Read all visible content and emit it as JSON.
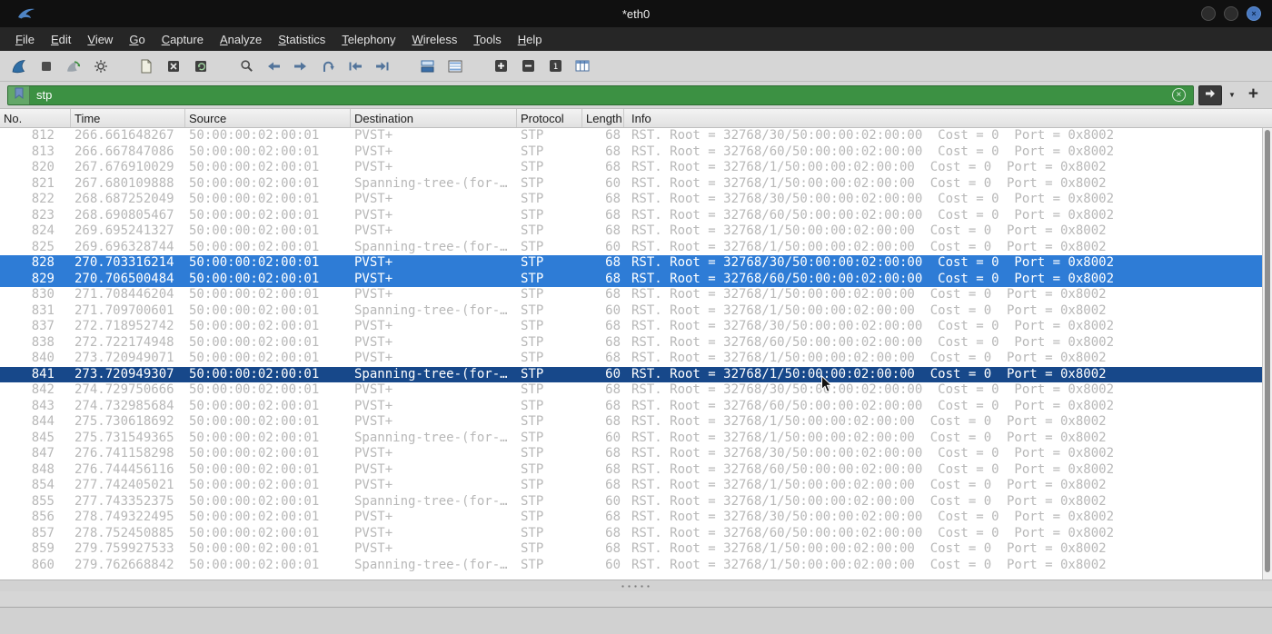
{
  "titlebar": {
    "title": "*eth0"
  },
  "menu": {
    "items": [
      "File",
      "Edit",
      "View",
      "Go",
      "Capture",
      "Analyze",
      "Statistics",
      "Telephony",
      "Wireless",
      "Tools",
      "Help"
    ]
  },
  "toolbar": {
    "icons": [
      "start-capture",
      "stop-capture",
      "restart-capture",
      "capture-options",
      "open-file",
      "close-file",
      "reload-file",
      "find-packet",
      "go-back",
      "go-forward",
      "go-to-packet",
      "go-first-packet",
      "go-last-packet",
      "auto-scroll",
      "colorize-packets",
      "zoom-in",
      "zoom-out",
      "zoom-original",
      "resize-columns"
    ]
  },
  "filter": {
    "value": "stp",
    "add_button_label": "+"
  },
  "packet_list": {
    "columns": [
      "No.",
      "Time",
      "Source",
      "Destination",
      "Protocol",
      "Length",
      "Info"
    ],
    "rows": [
      {
        "no": "812",
        "time": "266.661648267",
        "source": "50:00:00:02:00:01",
        "destination": "PVST+",
        "protocol": "STP",
        "length": "68",
        "info": "RST. Root = 32768/30/50:00:00:02:00:00  Cost = 0  Port = 0x8002"
      },
      {
        "no": "813",
        "time": "266.667847086",
        "source": "50:00:00:02:00:01",
        "destination": "PVST+",
        "protocol": "STP",
        "length": "68",
        "info": "RST. Root = 32768/60/50:00:00:02:00:00  Cost = 0  Port = 0x8002"
      },
      {
        "no": "820",
        "time": "267.676910029",
        "source": "50:00:00:02:00:01",
        "destination": "PVST+",
        "protocol": "STP",
        "length": "68",
        "info": "RST. Root = 32768/1/50:00:00:02:00:00  Cost = 0  Port = 0x8002"
      },
      {
        "no": "821",
        "time": "267.680109888",
        "source": "50:00:00:02:00:01",
        "destination": "Spanning-tree-(for-…",
        "protocol": "STP",
        "length": "60",
        "info": "RST. Root = 32768/1/50:00:00:02:00:00  Cost = 0  Port = 0x8002"
      },
      {
        "no": "822",
        "time": "268.687252049",
        "source": "50:00:00:02:00:01",
        "destination": "PVST+",
        "protocol": "STP",
        "length": "68",
        "info": "RST. Root = 32768/30/50:00:00:02:00:00  Cost = 0  Port = 0x8002"
      },
      {
        "no": "823",
        "time": "268.690805467",
        "source": "50:00:00:02:00:01",
        "destination": "PVST+",
        "protocol": "STP",
        "length": "68",
        "info": "RST. Root = 32768/60/50:00:00:02:00:00  Cost = 0  Port = 0x8002"
      },
      {
        "no": "824",
        "time": "269.695241327",
        "source": "50:00:00:02:00:01",
        "destination": "PVST+",
        "protocol": "STP",
        "length": "68",
        "info": "RST. Root = 32768/1/50:00:00:02:00:00  Cost = 0  Port = 0x8002"
      },
      {
        "no": "825",
        "time": "269.696328744",
        "source": "50:00:00:02:00:01",
        "destination": "Spanning-tree-(for-…",
        "protocol": "STP",
        "length": "60",
        "info": "RST. Root = 32768/1/50:00:00:02:00:00  Cost = 0  Port = 0x8002"
      },
      {
        "no": "828",
        "time": "270.703316214",
        "source": "50:00:00:02:00:01",
        "destination": "PVST+",
        "protocol": "STP",
        "length": "68",
        "info": "RST. Root = 32768/30/50:00:00:02:00:00  Cost = 0  Port = 0x8002",
        "state": "selected"
      },
      {
        "no": "829",
        "time": "270.706500484",
        "source": "50:00:00:02:00:01",
        "destination": "PVST+",
        "protocol": "STP",
        "length": "68",
        "info": "RST. Root = 32768/60/50:00:00:02:00:00  Cost = 0  Port = 0x8002",
        "state": "selected"
      },
      {
        "no": "830",
        "time": "271.708446204",
        "source": "50:00:00:02:00:01",
        "destination": "PVST+",
        "protocol": "STP",
        "length": "68",
        "info": "RST. Root = 32768/1/50:00:00:02:00:00  Cost = 0  Port = 0x8002"
      },
      {
        "no": "831",
        "time": "271.709700601",
        "source": "50:00:00:02:00:01",
        "destination": "Spanning-tree-(for-…",
        "protocol": "STP",
        "length": "60",
        "info": "RST. Root = 32768/1/50:00:00:02:00:00  Cost = 0  Port = 0x8002"
      },
      {
        "no": "837",
        "time": "272.718952742",
        "source": "50:00:00:02:00:01",
        "destination": "PVST+",
        "protocol": "STP",
        "length": "68",
        "info": "RST. Root = 32768/30/50:00:00:02:00:00  Cost = 0  Port = 0x8002"
      },
      {
        "no": "838",
        "time": "272.722174948",
        "source": "50:00:00:02:00:01",
        "destination": "PVST+",
        "protocol": "STP",
        "length": "68",
        "info": "RST. Root = 32768/60/50:00:00:02:00:00  Cost = 0  Port = 0x8002"
      },
      {
        "no": "840",
        "time": "273.720949071",
        "source": "50:00:00:02:00:01",
        "destination": "PVST+",
        "protocol": "STP",
        "length": "68",
        "info": "RST. Root = 32768/1/50:00:00:02:00:00  Cost = 0  Port = 0x8002"
      },
      {
        "no": "841",
        "time": "273.720949307",
        "source": "50:00:00:02:00:01",
        "destination": "Spanning-tree-(for-…",
        "protocol": "STP",
        "length": "60",
        "info": "RST. Root = 32768/1/50:00:00:02:00:00  Cost = 0  Port = 0x8002",
        "state": "current"
      },
      {
        "no": "842",
        "time": "274.729750666",
        "source": "50:00:00:02:00:01",
        "destination": "PVST+",
        "protocol": "STP",
        "length": "68",
        "info": "RST. Root = 32768/30/50:00:00:02:00:00  Cost = 0  Port = 0x8002"
      },
      {
        "no": "843",
        "time": "274.732985684",
        "source": "50:00:00:02:00:01",
        "destination": "PVST+",
        "protocol": "STP",
        "length": "68",
        "info": "RST. Root = 32768/60/50:00:00:02:00:00  Cost = 0  Port = 0x8002"
      },
      {
        "no": "844",
        "time": "275.730618692",
        "source": "50:00:00:02:00:01",
        "destination": "PVST+",
        "protocol": "STP",
        "length": "68",
        "info": "RST. Root = 32768/1/50:00:00:02:00:00  Cost = 0  Port = 0x8002"
      },
      {
        "no": "845",
        "time": "275.731549365",
        "source": "50:00:00:02:00:01",
        "destination": "Spanning-tree-(for-…",
        "protocol": "STP",
        "length": "60",
        "info": "RST. Root = 32768/1/50:00:00:02:00:00  Cost = 0  Port = 0x8002"
      },
      {
        "no": "847",
        "time": "276.741158298",
        "source": "50:00:00:02:00:01",
        "destination": "PVST+",
        "protocol": "STP",
        "length": "68",
        "info": "RST. Root = 32768/30/50:00:00:02:00:00  Cost = 0  Port = 0x8002"
      },
      {
        "no": "848",
        "time": "276.744456116",
        "source": "50:00:00:02:00:01",
        "destination": "PVST+",
        "protocol": "STP",
        "length": "68",
        "info": "RST. Root = 32768/60/50:00:00:02:00:00  Cost = 0  Port = 0x8002"
      },
      {
        "no": "854",
        "time": "277.742405021",
        "source": "50:00:00:02:00:01",
        "destination": "PVST+",
        "protocol": "STP",
        "length": "68",
        "info": "RST. Root = 32768/1/50:00:00:02:00:00  Cost = 0  Port = 0x8002"
      },
      {
        "no": "855",
        "time": "277.743352375",
        "source": "50:00:00:02:00:01",
        "destination": "Spanning-tree-(for-…",
        "protocol": "STP",
        "length": "60",
        "info": "RST. Root = 32768/1/50:00:00:02:00:00  Cost = 0  Port = 0x8002"
      },
      {
        "no": "856",
        "time": "278.749322495",
        "source": "50:00:00:02:00:01",
        "destination": "PVST+",
        "protocol": "STP",
        "length": "68",
        "info": "RST. Root = 32768/30/50:00:00:02:00:00  Cost = 0  Port = 0x8002"
      },
      {
        "no": "857",
        "time": "278.752450885",
        "source": "50:00:00:02:00:01",
        "destination": "PVST+",
        "protocol": "STP",
        "length": "68",
        "info": "RST. Root = 32768/60/50:00:00:02:00:00  Cost = 0  Port = 0x8002"
      },
      {
        "no": "859",
        "time": "279.759927533",
        "source": "50:00:00:02:00:01",
        "destination": "PVST+",
        "protocol": "STP",
        "length": "68",
        "info": "RST. Root = 32768/1/50:00:00:02:00:00  Cost = 0  Port = 0x8002"
      },
      {
        "no": "860",
        "time": "279.762668842",
        "source": "50:00:00:02:00:01",
        "destination": "Spanning-tree-(for-…",
        "protocol": "STP",
        "length": "60",
        "info": "RST. Root = 32768/1/50:00:00:02:00:00  Cost = 0  Port = 0x8002"
      }
    ]
  },
  "colors": {
    "titlebar_bg": "#101010",
    "menubar_bg": "#262626",
    "chrome_bg": "#d6d6d6",
    "filter_valid_bg": "#3c9143",
    "row_text": "#b8b8b8",
    "row_selected_bg": "#2e7cd6",
    "row_current_bg": "#17488a"
  }
}
